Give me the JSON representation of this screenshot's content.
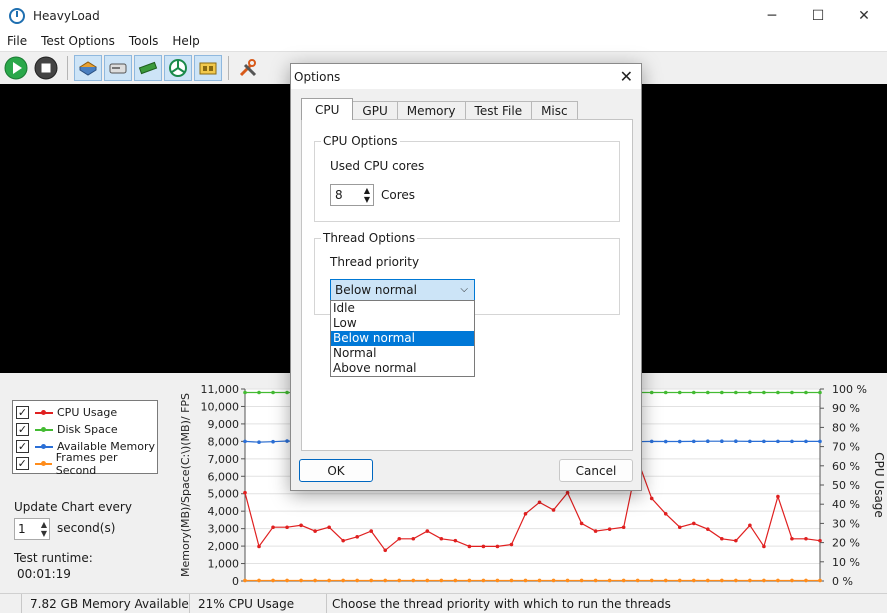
{
  "window": {
    "title": "HeavyLoad",
    "controls": [
      "─",
      "☐",
      "✕"
    ]
  },
  "menu": [
    "File",
    "Test Options",
    "Tools",
    "Help"
  ],
  "toolbar": {
    "buttons": [
      "play-icon",
      "stop-icon",
      "cpu-icon",
      "disk-icon",
      "memory-icon",
      "gpu-icon",
      "io-icon",
      "tools-icon"
    ]
  },
  "legend": [
    {
      "label": "CPU Usage",
      "color": "#e02020",
      "checked": "✓"
    },
    {
      "label": "Disk Space",
      "color": "#44bb33",
      "checked": "✓"
    },
    {
      "label": "Available Memory",
      "color": "#2b6fd6",
      "checked": "✓"
    },
    {
      "label": "Frames per Second",
      "color": "#ff8c1a",
      "checked": "✓"
    }
  ],
  "update_chart": {
    "label": "Update Chart every",
    "value": "1",
    "unit": "second(s)"
  },
  "runtime": {
    "label": "Test runtime:",
    "value": "00:01:19"
  },
  "status": {
    "memory": "7.82 GB Memory Available",
    "cpu": "21% CPU Usage",
    "hint": "Choose the thread priority with which to run the threads"
  },
  "dialog": {
    "title": "Options",
    "close": "✕",
    "tabs": [
      "CPU",
      "GPU",
      "Memory",
      "Test File",
      "Misc"
    ],
    "active_tab": "CPU",
    "cpu_options": {
      "title": "CPU Options",
      "cores_label": "Used CPU cores",
      "cores_value": "8",
      "cores_unit": "Cores"
    },
    "thread_options": {
      "title": "Thread Options",
      "priority_label": "Thread priority",
      "selected": "Below normal",
      "options": [
        "Idle",
        "Low",
        "Below normal",
        "Normal",
        "Above normal"
      ]
    },
    "ok": "OK",
    "cancel": "Cancel"
  },
  "chart_data": {
    "type": "line",
    "left_axis_label": "Memory(MB)/Space(C:\\)(MB)/ FPS",
    "right_axis_label": "CPU Usage",
    "left_ticks": [
      "11,000",
      "10,000",
      "9,000",
      "8,000",
      "7,000",
      "6,000",
      "5,000",
      "4,000",
      "3,000",
      "2,000",
      "1,000",
      "0"
    ],
    "right_ticks": [
      "100 %",
      "90 %",
      "80 %",
      "70 %",
      "60 %",
      "50 %",
      "40 %",
      "30 %",
      "20 %",
      "10 %",
      "0 %"
    ],
    "ylim_left": [
      0,
      11000
    ],
    "ylim_right": [
      0,
      100
    ],
    "grid": true,
    "series": [
      {
        "name": "Disk Space",
        "color": "#44bb33",
        "axis": "left",
        "values": [
          10800,
          10800,
          10800,
          10800,
          10800,
          10800,
          10800,
          10800,
          10800,
          10800,
          10800,
          10800,
          10800,
          10800,
          10800,
          10800,
          10800,
          10800,
          10800,
          10800,
          10800,
          10800,
          10800,
          10800,
          10800,
          10800,
          10800,
          10800,
          10800,
          10800,
          10800,
          10800,
          10800,
          10800,
          10800,
          10800,
          10800,
          10800,
          10800,
          10800,
          10800,
          10800
        ]
      },
      {
        "name": "Available Memory",
        "color": "#2b6fd6",
        "axis": "left",
        "values": [
          8000,
          7950,
          7980,
          8020,
          7990,
          8000,
          7980,
          8010,
          8000,
          7990,
          8000,
          7970,
          8000,
          7990,
          8000,
          8010,
          8000,
          7980,
          8000,
          7990,
          8000,
          8010,
          8000,
          7990,
          8000,
          8010,
          7990,
          8000,
          7980,
          8000,
          7990,
          7990,
          8000,
          8010,
          8010,
          8010,
          8000,
          8000,
          8000,
          8000,
          8000,
          8000
        ]
      },
      {
        "name": "CPU Usage",
        "color": "#e02020",
        "axis": "right",
        "values": [
          46,
          18,
          28,
          28,
          29,
          26,
          28,
          21,
          23,
          26,
          16,
          22,
          22,
          26,
          22,
          21,
          18,
          18,
          18,
          19,
          35,
          41,
          37,
          46,
          30,
          26,
          27,
          28,
          63,
          43,
          35,
          28,
          30,
          27,
          22,
          21,
          29,
          18,
          44,
          22,
          22,
          21
        ]
      },
      {
        "name": "Frames per Second",
        "color": "#ff8c1a",
        "axis": "left",
        "values": [
          30,
          30,
          30,
          30,
          30,
          30,
          30,
          30,
          30,
          30,
          30,
          30,
          30,
          30,
          30,
          30,
          30,
          30,
          30,
          30,
          30,
          30,
          30,
          30,
          30,
          30,
          30,
          30,
          30,
          30,
          30,
          30,
          30,
          30,
          30,
          30,
          30,
          30,
          30,
          30,
          30,
          30
        ]
      }
    ]
  }
}
